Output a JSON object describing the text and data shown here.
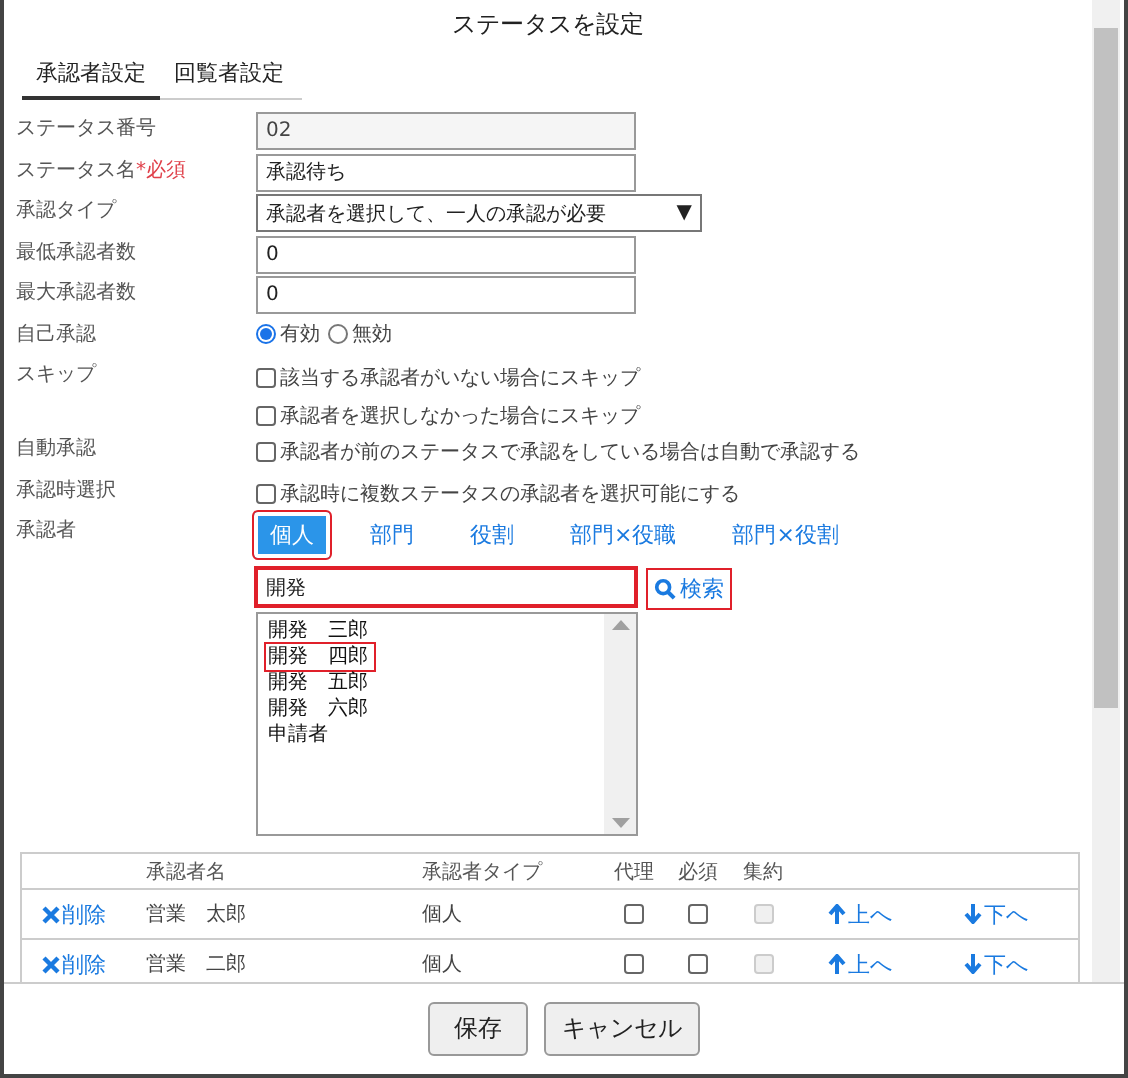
{
  "dialog": {
    "title": "ステータスを設定"
  },
  "tabs": [
    {
      "label": "承認者設定",
      "selected": true
    },
    {
      "label": "回覧者設定",
      "selected": false
    }
  ],
  "form": [
    {
      "kind": "text",
      "label": "ステータス番号",
      "value": "02",
      "disabled": true
    },
    {
      "kind": "text",
      "label": "ステータス名",
      "required_mark": "*必須",
      "value": "承認待ち",
      "disabled": false
    },
    {
      "kind": "select",
      "label": "承認タイプ",
      "value": "承認者を選択して、一人の承認が必要",
      "caret": "▼"
    },
    {
      "kind": "text",
      "label": "最低承認者数",
      "value": "0",
      "disabled": false
    },
    {
      "kind": "text",
      "label": "最大承認者数",
      "value": "0",
      "disabled": false
    },
    {
      "kind": "radio",
      "label": "自己承認",
      "options": [
        {
          "label": "有効",
          "selected": true
        },
        {
          "label": "無効",
          "selected": false
        }
      ]
    },
    {
      "kind": "checks",
      "label": "スキップ",
      "options": [
        {
          "label": "該当する承認者がいない場合にスキップ",
          "checked": false
        },
        {
          "label": "承認者を選択しなかった場合にスキップ",
          "checked": false
        }
      ]
    },
    {
      "kind": "checks",
      "label": "自動承認",
      "options": [
        {
          "label": "承認者が前のステータスで承認をしている場合は自動で承認する",
          "checked": false
        }
      ]
    },
    {
      "kind": "checks",
      "label": "承認時選択",
      "options": [
        {
          "label": "承認時に複数ステータスの承認者を選択可能にする",
          "checked": false
        }
      ]
    }
  ],
  "approver": {
    "label": "承認者",
    "types": [
      {
        "label": "個人",
        "selected": true,
        "highlighted": true
      },
      {
        "label": "部門",
        "selected": false,
        "highlighted": false
      },
      {
        "label": "役割",
        "selected": false,
        "highlighted": false
      },
      {
        "label": "部門×役職",
        "selected": false,
        "highlighted": false
      },
      {
        "label": "部門×役割",
        "selected": false,
        "highlighted": false
      }
    ],
    "search": {
      "value": "開発",
      "highlighted": true
    },
    "search_button": {
      "label": "検索",
      "highlighted": true
    },
    "candidates": [
      {
        "label": "開発　三郎",
        "highlighted": false
      },
      {
        "label": "開発　四郎",
        "highlighted": true
      },
      {
        "label": "開発　五郎",
        "highlighted": false
      },
      {
        "label": "開発　六郎",
        "highlighted": false
      },
      {
        "label": "申請者",
        "highlighted": false
      }
    ]
  },
  "table": {
    "columns": {
      "name": "承認者名",
      "type": "承認者タイプ",
      "proxy": "代理",
      "required": "必須",
      "aggregate": "集約"
    },
    "rows": [
      {
        "delete": "削除",
        "name": "営業　太郎",
        "type": "個人",
        "proxy_checked": false,
        "required_checked": false,
        "aggregate_checked": false,
        "aggregate_disabled": true,
        "up": "上へ",
        "down": "下へ"
      },
      {
        "delete": "削除",
        "name": "営業　二郎",
        "type": "個人",
        "proxy_checked": false,
        "required_checked": false,
        "aggregate_checked": false,
        "aggregate_disabled": true,
        "up": "上へ",
        "down": "下へ"
      }
    ]
  },
  "buttons": [
    "保存",
    "キャンセル"
  ]
}
